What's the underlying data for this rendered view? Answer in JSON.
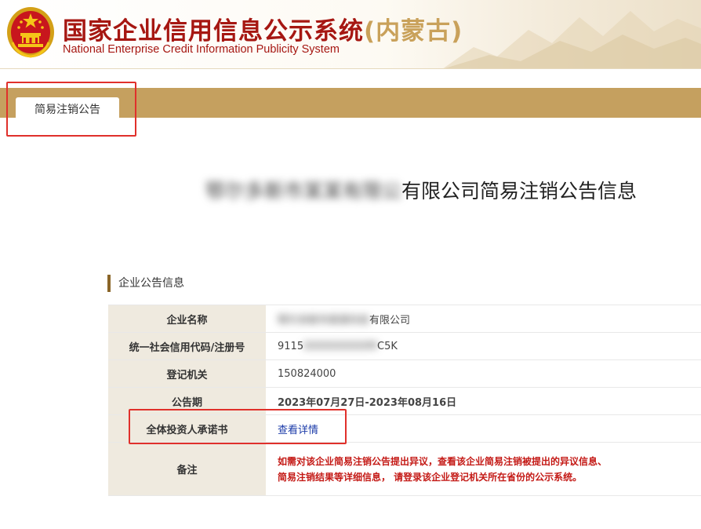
{
  "header": {
    "title_cn_main": "国家企业信用信息公示系统",
    "title_cn_region": "(内蒙古)",
    "title_en": "National Enterprise Credit Information Publicity System"
  },
  "tabs": [
    {
      "label": "简易注销公告"
    }
  ],
  "notice": {
    "company_prefix_redacted": "鄂尔多斯市某某有限公",
    "title_suffix": "有限公司简易注销公告信息"
  },
  "section": {
    "title": "企业公告信息"
  },
  "table": {
    "rows": [
      {
        "label": "企业名称",
        "value_redacted": "鄂尔多斯市某某科技",
        "value_suffix": "有限公司"
      },
      {
        "label": "统一社会信用代码/注册号",
        "value_prefix": "9115",
        "value_redacted": "0000000000M",
        "value_suffix": "C5K"
      },
      {
        "label": "登记机关",
        "value": "150824000"
      },
      {
        "label": "公告期",
        "value": "2023年07月27日-2023年08月16日"
      },
      {
        "label": "全体投资人承诺书",
        "value": "查看详情"
      },
      {
        "label": "备注",
        "value_line1": "如需对该企业简易注销公告提出异议，查看该企业简易注销被提出的异议信息、",
        "value_line2": "简易注销结果等详细信息， 请登录该企业登记机关所在省份的公示系统。"
      }
    ]
  },
  "colors": {
    "brand_red": "#a61712",
    "tab_bar": "#c5a05f",
    "label_bg": "#efeadf",
    "highlight": "#e0302b",
    "link": "#1a3aa8"
  }
}
